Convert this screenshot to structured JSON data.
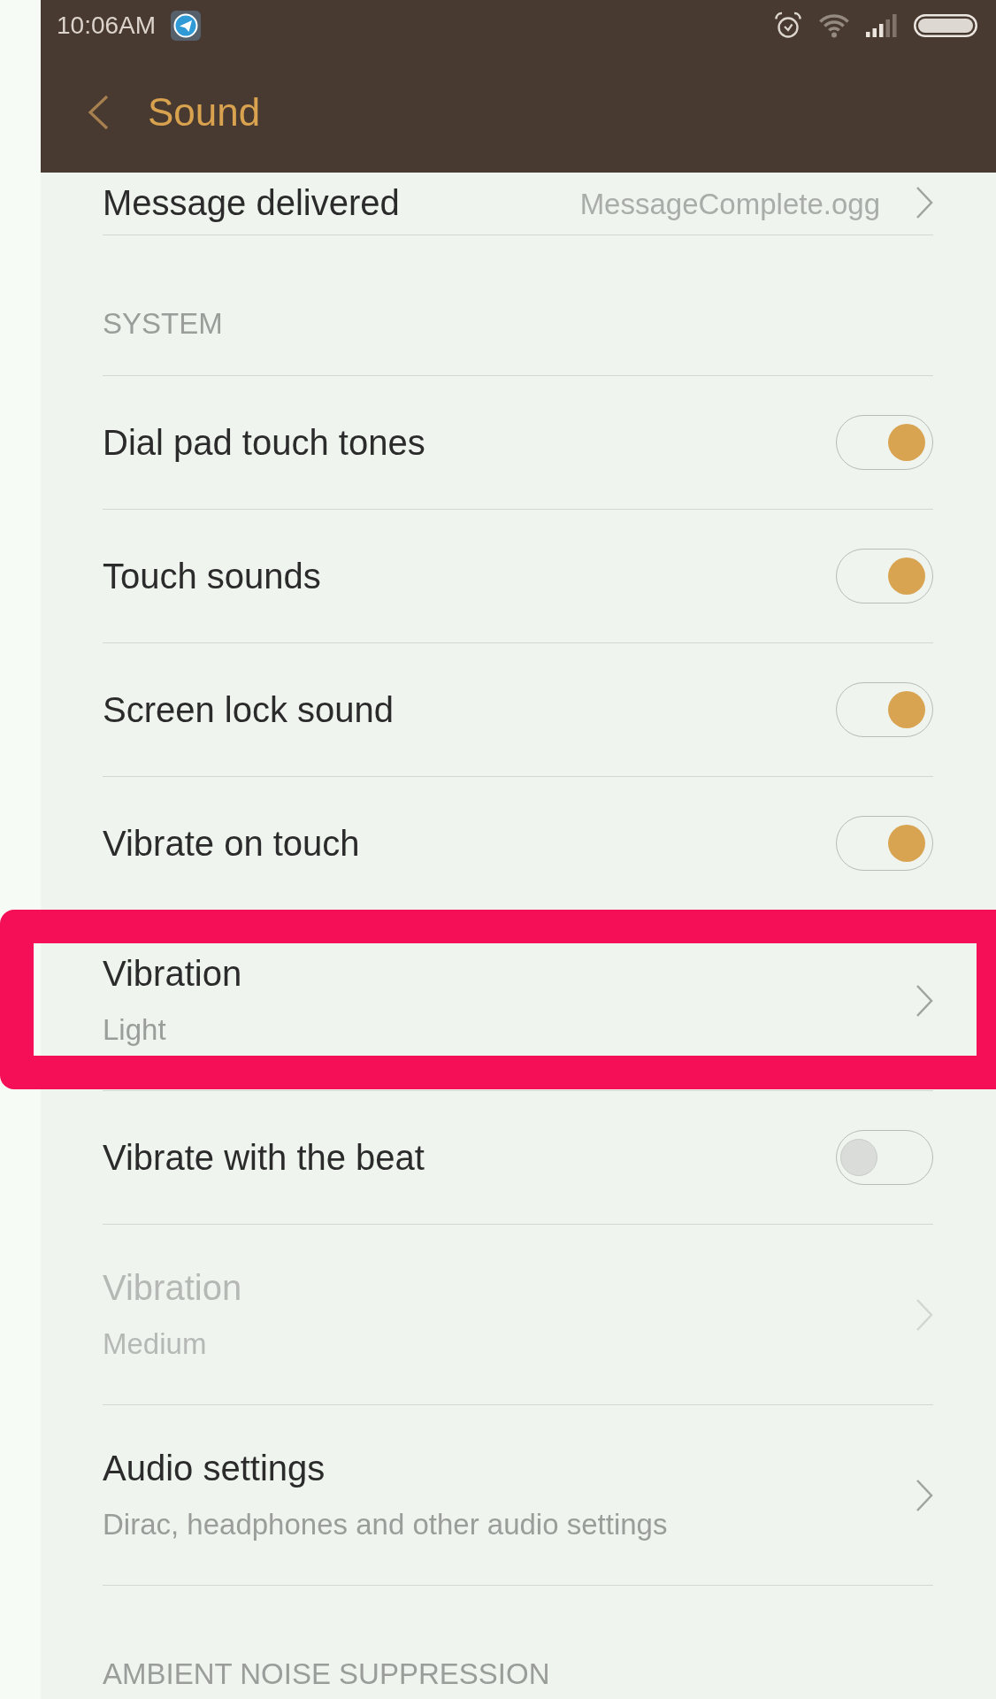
{
  "status_bar": {
    "time": "10:06AM"
  },
  "header": {
    "title": "Sound"
  },
  "sections": [
    {
      "items": [
        {
          "kind": "value",
          "title": "Message delivered",
          "value": "MessageComplete.ogg",
          "disabled": false,
          "highlighted": false
        }
      ]
    },
    {
      "heading": "SYSTEM",
      "items": [
        {
          "kind": "toggle",
          "title": "Dial pad touch tones",
          "on": true,
          "disabled": false,
          "highlighted": false
        },
        {
          "kind": "toggle",
          "title": "Touch sounds",
          "on": true,
          "disabled": false,
          "highlighted": false
        },
        {
          "kind": "toggle",
          "title": "Screen lock sound",
          "on": true,
          "disabled": false,
          "highlighted": false
        },
        {
          "kind": "toggle",
          "title": "Vibrate on touch",
          "on": true,
          "disabled": false,
          "highlighted": false
        },
        {
          "kind": "link",
          "title": "Vibration",
          "subtitle": "Light",
          "disabled": false,
          "highlighted": true
        },
        {
          "kind": "toggle",
          "title": "Vibrate with the beat",
          "on": false,
          "disabled": false,
          "highlighted": false
        },
        {
          "kind": "link",
          "title": "Vibration",
          "subtitle": "Medium",
          "disabled": true,
          "highlighted": false
        },
        {
          "kind": "link",
          "title": "Audio settings",
          "subtitle": "Dirac, headphones and other audio settings",
          "disabled": false,
          "highlighted": false
        }
      ]
    },
    {
      "heading": "AMBIENT NOISE SUPPRESSION"
    }
  ]
}
